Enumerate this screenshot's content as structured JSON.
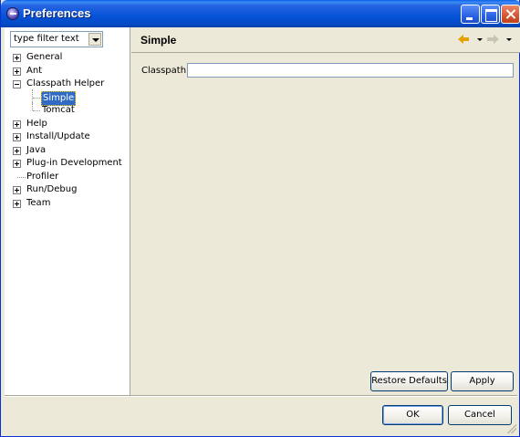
{
  "window": {
    "title": "Preferences"
  },
  "sidebar": {
    "filter": {
      "value": "type filter text"
    },
    "tree": [
      {
        "label": "General",
        "expander": "plus",
        "level": 0
      },
      {
        "label": "Ant",
        "expander": "plus",
        "level": 0
      },
      {
        "label": "Classpath Helper",
        "expander": "minus",
        "level": 0
      },
      {
        "label": "Simple",
        "expander": "none",
        "level": 1,
        "selected": true
      },
      {
        "label": "Tomcat",
        "expander": "none",
        "level": 1
      },
      {
        "label": "Help",
        "expander": "plus",
        "level": 0
      },
      {
        "label": "Install/Update",
        "expander": "plus",
        "level": 0
      },
      {
        "label": "Java",
        "expander": "plus",
        "level": 0
      },
      {
        "label": "Plug-in Development",
        "expander": "plus",
        "level": 0
      },
      {
        "label": "Profiler",
        "expander": "none",
        "level": 0
      },
      {
        "label": "Run/Debug",
        "expander": "plus",
        "level": 0
      },
      {
        "label": "Team",
        "expander": "plus",
        "level": 0
      }
    ]
  },
  "page": {
    "title": "Simple",
    "classpath_label": "Classpath",
    "classpath_value": "",
    "restore_label": "Restore Defaults",
    "apply_label": "Apply"
  },
  "dialog": {
    "ok_label": "OK",
    "cancel_label": "Cancel"
  },
  "colors": {
    "selection": "#316ac5",
    "nav_arrow_active": "#e5a100",
    "titlebar": "#0553d8"
  }
}
